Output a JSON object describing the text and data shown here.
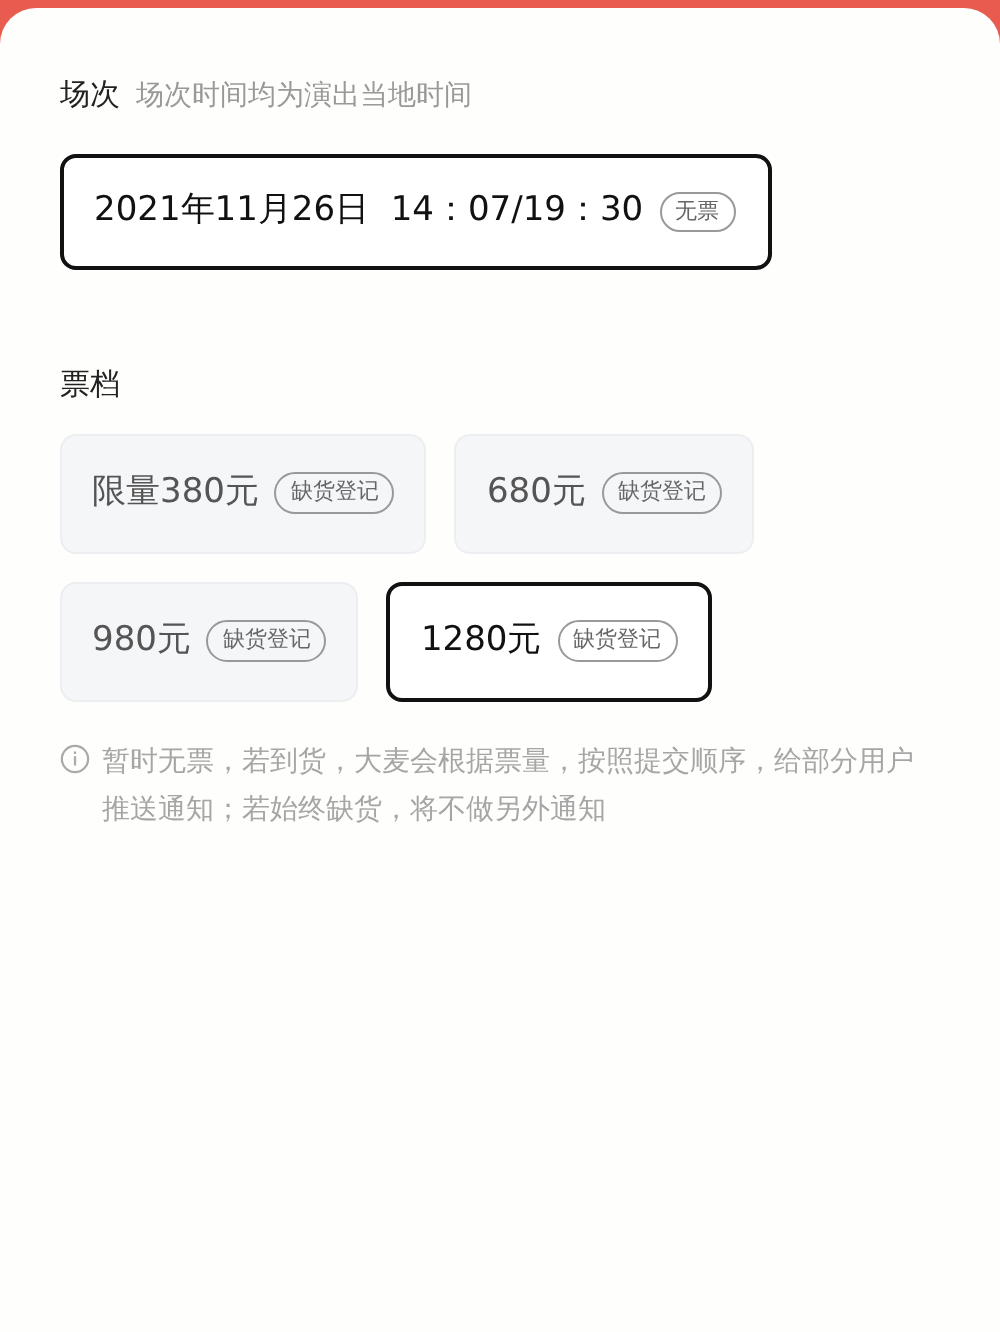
{
  "session": {
    "title": "场次",
    "hint": "场次时间均为演出当地时间",
    "options": [
      {
        "label": "2021年11月26日  14：07/19：30",
        "badge": "无票",
        "selected": true
      }
    ]
  },
  "tiers": {
    "title": "票档",
    "items": [
      {
        "label": "限量380元",
        "badge": "缺货登记",
        "selected": false
      },
      {
        "label": "680元",
        "badge": "缺货登记",
        "selected": false
      },
      {
        "label": "980元",
        "badge": "缺货登记",
        "selected": false
      },
      {
        "label": "1280元",
        "badge": "缺货登记",
        "selected": true
      }
    ]
  },
  "notice": "暂时无票，若到货，大麦会根据票量，按照提交顺序，给部分用户推送通知；若始终缺货，将不做另外通知"
}
